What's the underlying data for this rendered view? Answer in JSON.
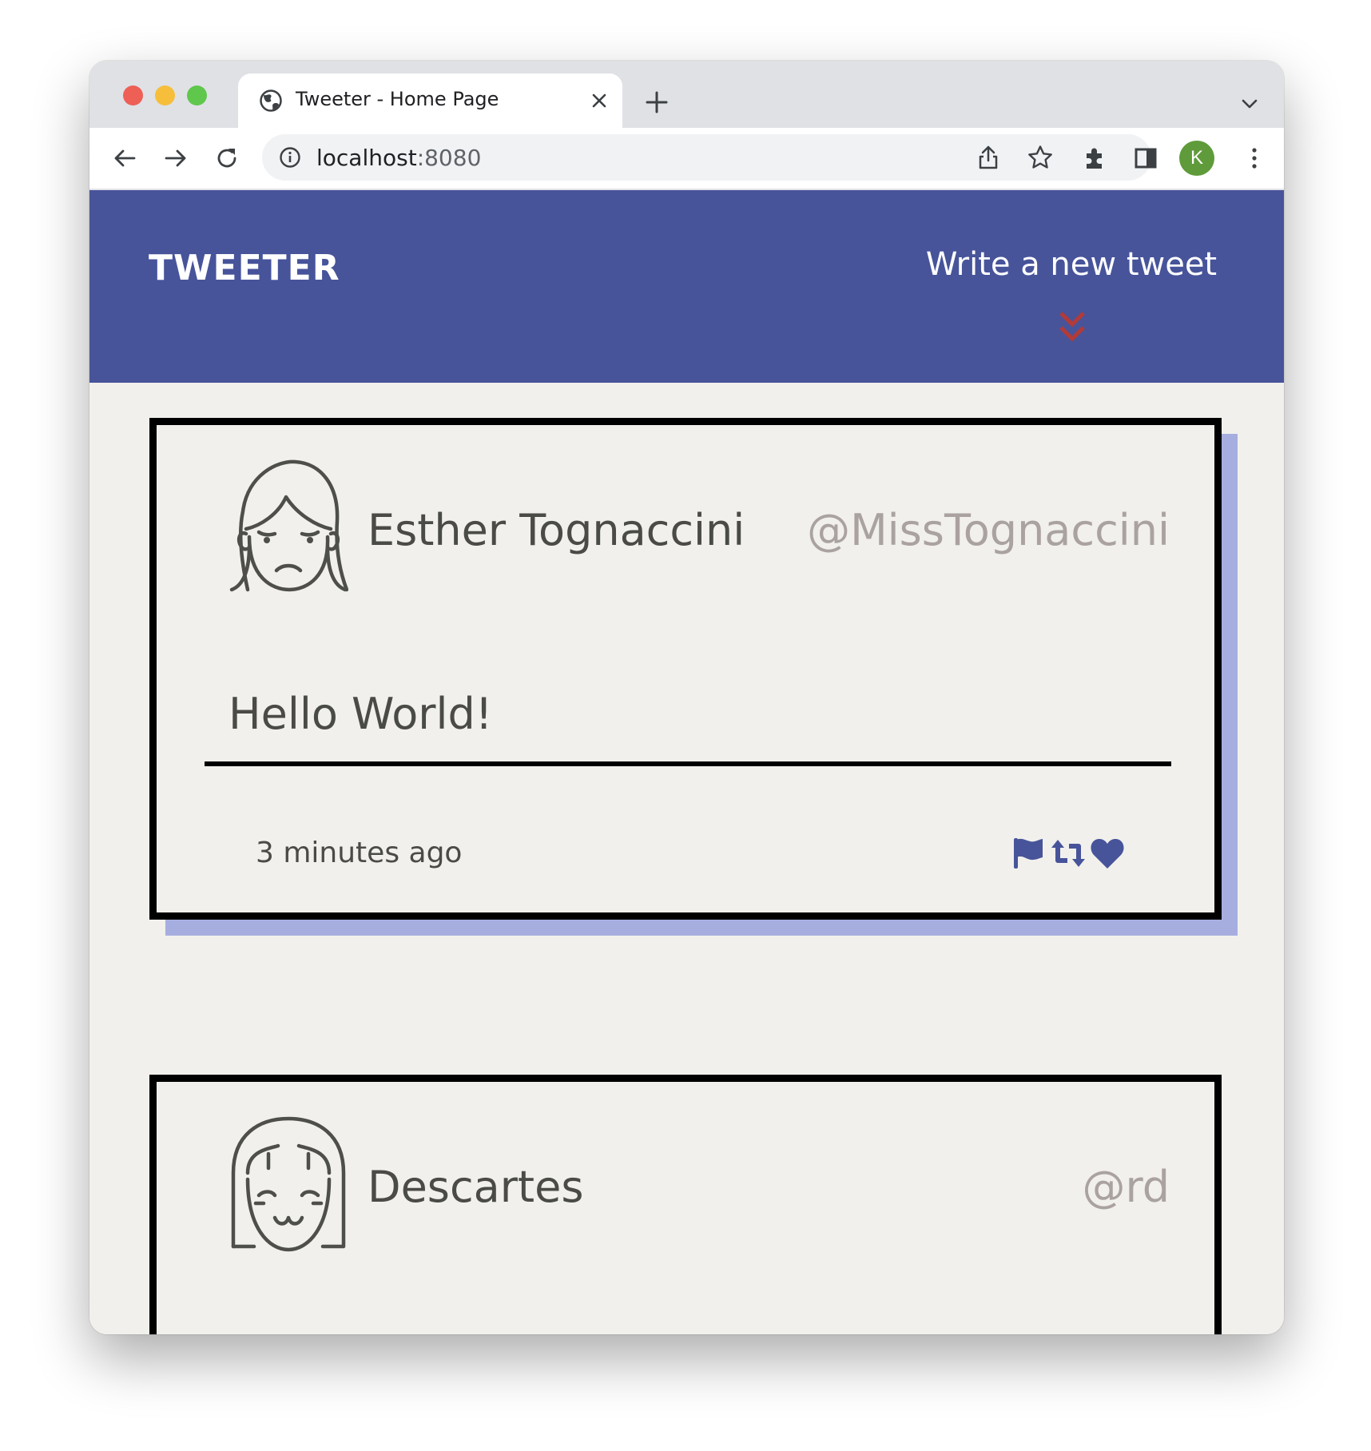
{
  "browser": {
    "tab_title": "Tweeter - Home Page",
    "url_host": "localhost",
    "url_port": ":8080",
    "profile_initial": "K"
  },
  "header": {
    "brand": "TWEETER",
    "compose_label": "Write a new tweet",
    "background_color": "#47549a",
    "arrow_color": "#b23a38"
  },
  "tweets": [
    {
      "name": "Esther Tognaccini",
      "handle": "@MissTognaccini",
      "content": "Hello World!",
      "time": "3 minutes ago",
      "avatar_icon": "female-avatar-icon"
    },
    {
      "name": "Descartes",
      "handle": "@rd",
      "avatar_icon": "girl-avatar-icon"
    }
  ],
  "colors": {
    "accent": "#47549a",
    "card_shadow": "#a6aee0",
    "page_background": "#f1f0ec",
    "handle_text": "#aaa2a0"
  }
}
